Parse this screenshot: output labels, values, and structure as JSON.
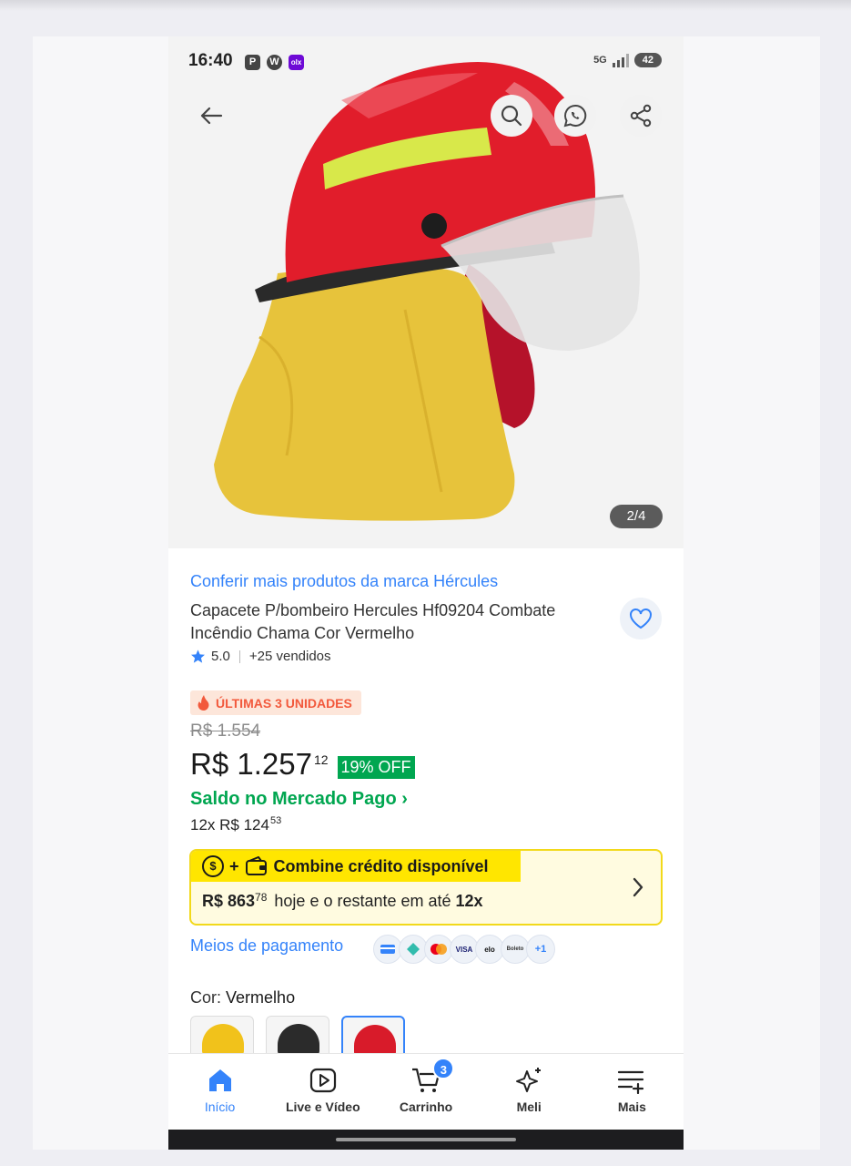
{
  "status_bar": {
    "time": "16:40",
    "apps": [
      "P",
      "W",
      "olx"
    ],
    "network": "5G",
    "battery": "42"
  },
  "gallery": {
    "counter": "2/4",
    "back_icon": "arrow-left-icon",
    "search_icon": "search-icon",
    "whatsapp_icon": "whatsapp-icon",
    "share_icon": "share-icon"
  },
  "product": {
    "brand_link": "Conferir mais produtos da marca Hércules",
    "title": "Capacete P/bombeiro Hercules Hf09204 Combate Incêndio Chama Cor Vermelho",
    "rating": "5.0",
    "sold": "+25 vendidos",
    "stock_badge": "ÚLTIMAS 3 UNIDADES",
    "old_price": "R$ 1.554",
    "price": "R$ 1.257",
    "price_cents": "12",
    "discount": "19% OFF",
    "saldo_link": "Saldo no Mercado Pago ›",
    "installments": "12x R$ 124",
    "installments_cents": "53"
  },
  "credit": {
    "title": "Combine crédito disponível",
    "amount": "R$ 863",
    "amount_cents": "78",
    "text_mid": "hoje e o restante em até",
    "text_end": "12x"
  },
  "payment": {
    "link": "Meios de pagamento",
    "methods": [
      "",
      "",
      "",
      "VISA",
      "elo",
      "Boleto",
      "+1"
    ]
  },
  "color": {
    "label": "Cor:",
    "selected": "Vermelho",
    "options": [
      "Amarelo",
      "Preto",
      "Vermelho"
    ]
  },
  "nav": {
    "items": [
      {
        "label": "Início",
        "icon": "home-icon"
      },
      {
        "label": "Live e Vídeo",
        "icon": "play-icon"
      },
      {
        "label": "Carrinho",
        "icon": "cart-icon"
      },
      {
        "label": "Meli",
        "icon": "sparkle-icon"
      },
      {
        "label": "Mais",
        "icon": "menu-plus-icon"
      }
    ],
    "cart_count": "3"
  },
  "colors": {
    "accent_blue": "#3483fa",
    "green": "#00a650",
    "yellow": "#ffe600",
    "orange": "#f2593c"
  }
}
